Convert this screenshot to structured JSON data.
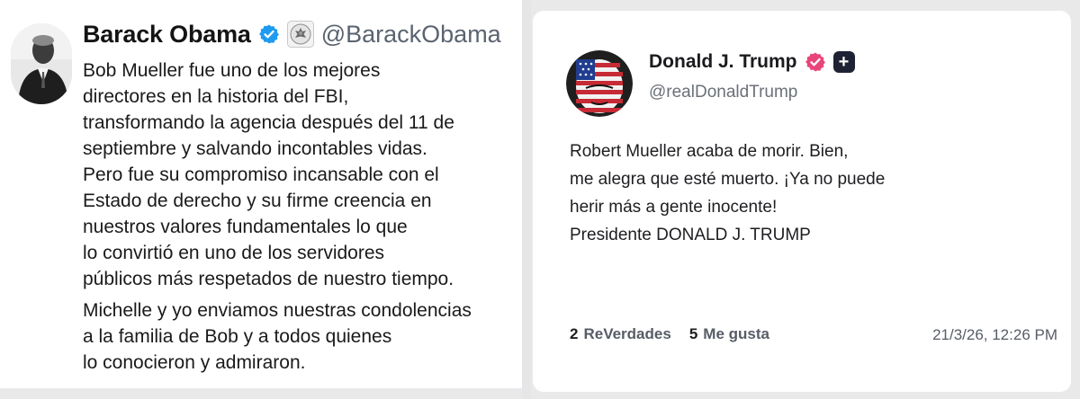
{
  "left_post": {
    "author_name": "Barack Obama",
    "handle": "@BarackObama",
    "verified_icon": "blue-verified-badge",
    "affiliation_icon": "presidential-seal",
    "lines_para1": [
      "Bob Mueller fue uno de los mejores",
      "directores en la historia del FBI,",
      "transformando la agencia después del 11 de",
      "septiembre y salvando incontables vidas.",
      "Pero fue su compromiso incansable con el",
      "Estado de derecho y su firme creencia en",
      "nuestros valores fundamentales lo que",
      "lo convirtió en uno de los servidores",
      "públicos más respetados de nuestro tiempo."
    ],
    "lines_para2": [
      "Michelle y yo enviamos nuestras condolencias",
      "a la familia de Bob y a todos quienes",
      "lo conocieron y admiraron."
    ]
  },
  "right_post": {
    "author_name": "Donald J. Trump",
    "handle": "@realDonaldTrump",
    "verified_icon": "pink-verified-badge",
    "plus_icon": "plus-badge",
    "plus_symbol": "+",
    "lines": [
      "Robert Mueller acaba de morir. Bien,",
      "me alegra que esté muerto. ¡Ya no puede",
      "herir más a gente inocente!",
      "Presidente DONALD J. TRUMP"
    ],
    "reposts_count": "2",
    "reposts_label": "ReVerdades",
    "likes_count": "5",
    "likes_label": "Me gusta",
    "timestamp": "21/3/26, 12:26 PM"
  },
  "colors": {
    "background": "#e9e9ea",
    "twitter_blue": "#1d9bf0",
    "truth_pink": "#e8467a",
    "plus_badge": "#1e2233"
  }
}
